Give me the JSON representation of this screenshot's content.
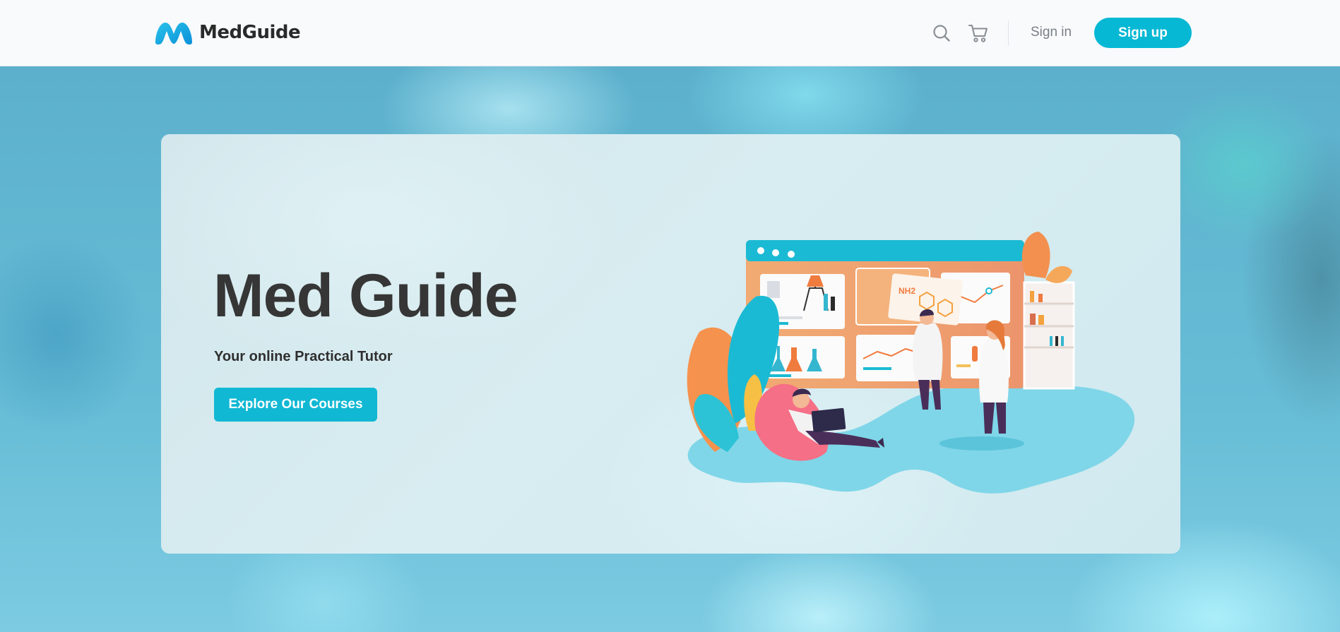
{
  "header": {
    "brand": "MedGuide",
    "icons": [
      "search-icon",
      "cart-icon"
    ],
    "signin_label": "Sign in",
    "signup_label": "Sign up"
  },
  "hero": {
    "title": "Med Guide",
    "subtitle": "Your online Practical Tutor",
    "cta_label": "Explore Our Courses",
    "illustration_text": "NH2"
  },
  "colors": {
    "accent": "#06b8d4",
    "title_text": "#363636",
    "header_bg": "#f8fafc"
  }
}
